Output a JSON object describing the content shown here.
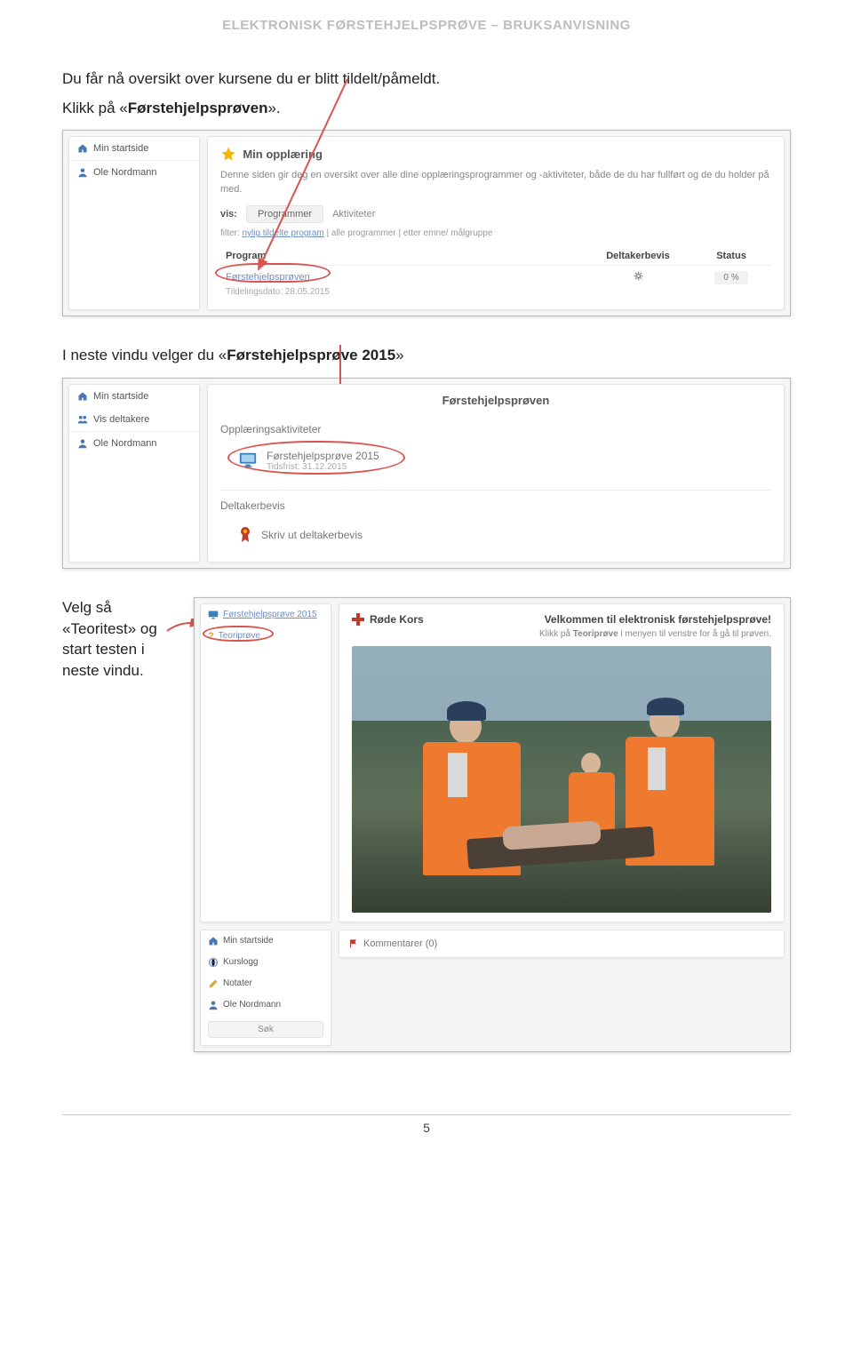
{
  "header": "ELEKTRONISK FØRSTEHJELPSPRØVE – BRUKSANVISNING",
  "intro": {
    "line1": "Du får nå oversikt over kursene du er blitt tildelt/påmeldt.",
    "line2_pre": "Klikk på «",
    "line2_bold": "Førstehjelpsprøven",
    "line2_post": "»."
  },
  "panel1": {
    "sidebar": {
      "home": "Min startside",
      "user": "Ole Nordmann"
    },
    "title": "Min opplæring",
    "desc": "Denne siden gir deg en oversikt over alle dine opplæringsprogrammer og -aktiviteter, både de du har fullført og de du holder på med.",
    "vis_label": "vis:",
    "tab1": "Programmer",
    "tab2": "Aktiviteter",
    "filter_label": "filter:",
    "filter_a": "nylig tildelte program",
    "filter_b": "alle programmer",
    "filter_c": "etter emne/ målgruppe",
    "col_program": "Program",
    "col_dbevis": "Deltakerbevis",
    "col_status": "Status",
    "row_name": "Førstehjelpsprøven",
    "row_status": "0 %",
    "row_date": "Tildelingsdato: 28.05.2015"
  },
  "mid_text_pre": "I neste vindu velger du «",
  "mid_text_bold": "Førstehjelpsprøve 2015",
  "mid_text_post": "»",
  "panel2": {
    "sidebar": {
      "home": "Min startside",
      "deltakere": "Vis deltakere",
      "user": "Ole Nordmann"
    },
    "title": "Førstehjelpsprøven",
    "section1": "Opplæringsaktiviteter",
    "activity": "Førstehjelpsprøve 2015",
    "activity_sub": "Tidsfrist: 31.12.2015",
    "section2": "Deltakerbevis",
    "print": "Skriv ut deltakerbevis"
  },
  "row3_text": {
    "line1": "Velg så",
    "line2_pre": "«",
    "line2_bold": "Teoritest",
    "line2_post": "» og",
    "line3": "start testen i",
    "line4": "neste vindu."
  },
  "panel3": {
    "top_sidebar": {
      "link1": "Førstehjelpsprøve 2015",
      "link2": "Teoriprøve"
    },
    "brand": "Røde Kors",
    "headline": "Velkommen til elektronisk førstehjelpsprøve!",
    "sub_pre": "Klikk på ",
    "sub_bold": "Teoriprøve",
    "sub_post": " i menyen til venstre for å gå til prøven.",
    "bot_sidebar": {
      "home": "Min startside",
      "kurslogg": "Kurslogg",
      "notater": "Notater",
      "user": "Ole Nordmann",
      "search": "Søk"
    },
    "comments": "Kommentarer (0)"
  },
  "page_number": "5"
}
